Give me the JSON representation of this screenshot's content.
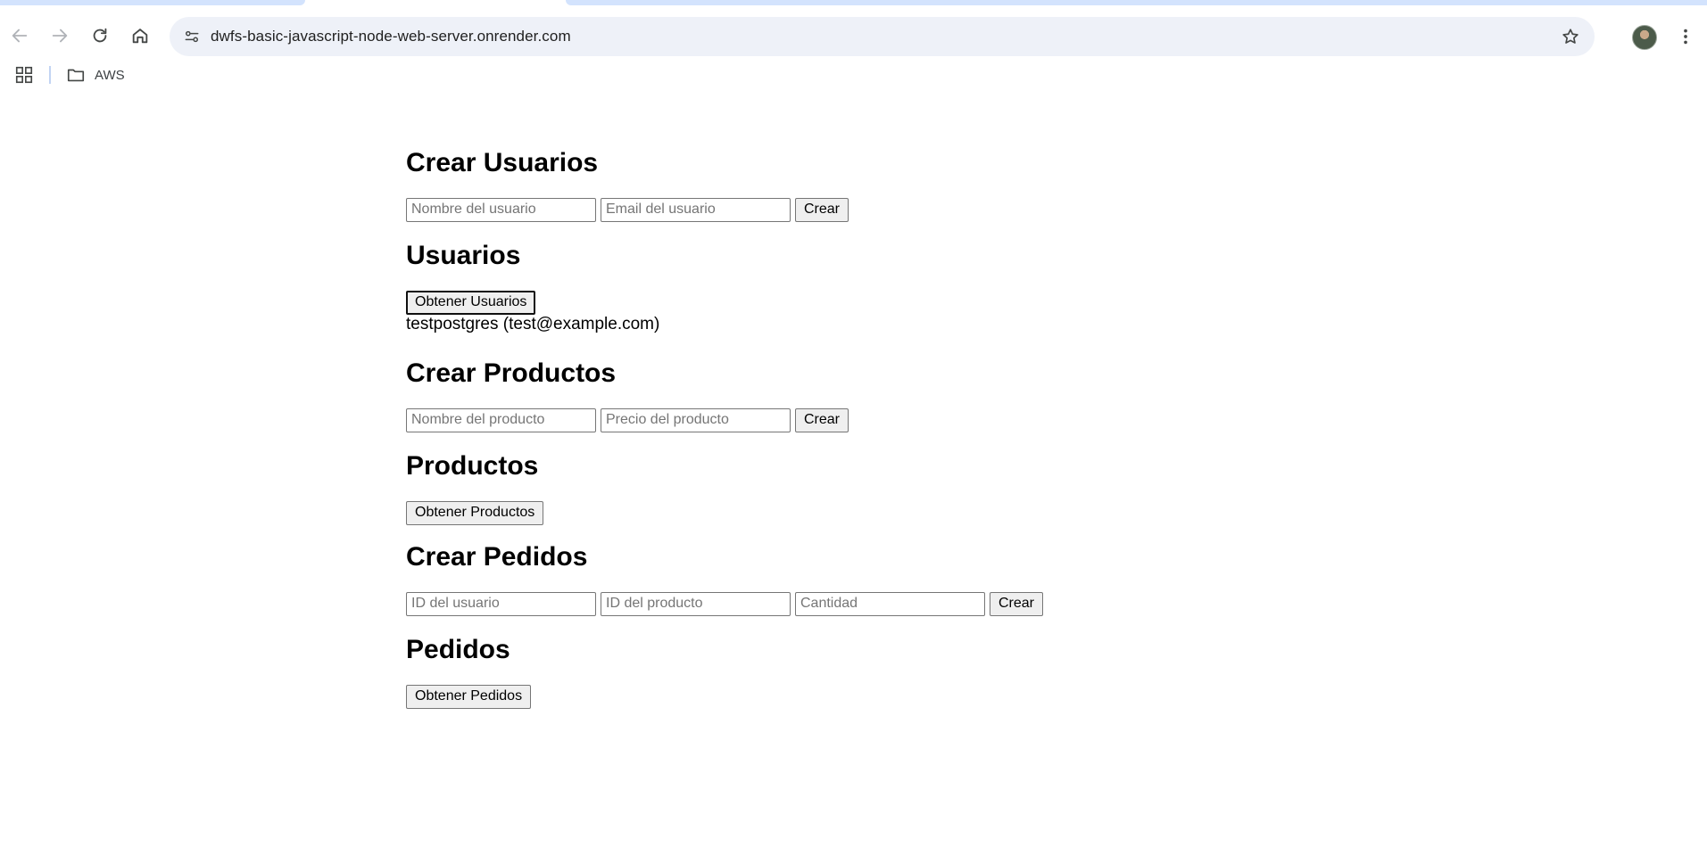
{
  "browser": {
    "url": "dwfs-basic-javascript-node-web-server.onrender.com",
    "bookmarks": [
      {
        "label": "AWS",
        "icon": "folder-icon"
      }
    ],
    "accent": "#d3e3fd"
  },
  "page": {
    "create_users": {
      "title": "Crear Usuarios",
      "name_placeholder": "Nombre del usuario",
      "email_placeholder": "Email del usuario",
      "submit_label": "Crear"
    },
    "users": {
      "title": "Usuarios",
      "fetch_label": "Obtener Usuarios",
      "results": [
        "testpostgres (test@example.com)"
      ]
    },
    "create_products": {
      "title": "Crear Productos",
      "name_placeholder": "Nombre del producto",
      "price_placeholder": "Precio del producto",
      "submit_label": "Crear"
    },
    "products": {
      "title": "Productos",
      "fetch_label": "Obtener Productos"
    },
    "create_orders": {
      "title": "Crear Pedidos",
      "user_id_placeholder": "ID del usuario",
      "product_id_placeholder": "ID del producto",
      "quantity_placeholder": "Cantidad",
      "submit_label": "Crear"
    },
    "orders": {
      "title": "Pedidos",
      "fetch_label": "Obtener Pedidos"
    }
  }
}
